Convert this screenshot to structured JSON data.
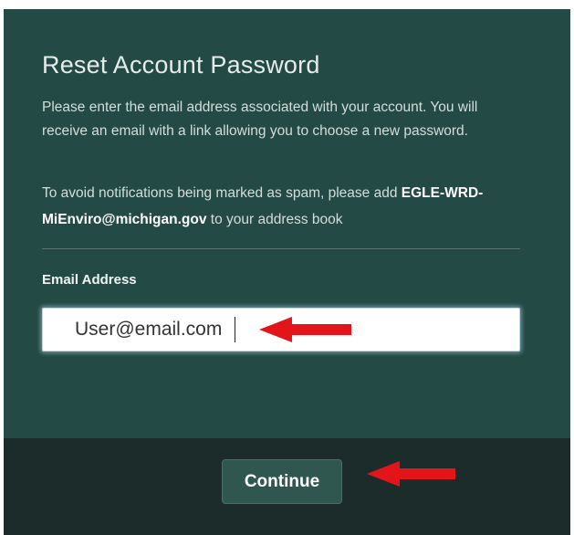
{
  "dialog": {
    "title": "Reset Account Password",
    "description": "Please enter the email address associated with your account. You will receive an email with a link allowing you to choose a new password.",
    "spam_note_prefix": "To avoid notifications being marked as spam, please add ",
    "spam_note_email": "EGLE-WRD-MiEnviro@michigan.gov",
    "spam_note_suffix": " to your address book"
  },
  "form": {
    "email_label": "Email Address",
    "email_value": "User@email.com"
  },
  "footer": {
    "continue_label": "Continue"
  },
  "annotations": {
    "arrow_color": "#e3151a"
  },
  "colors": {
    "dialog_background": "#234a45",
    "footer_background": "#1b2c2b",
    "button_background": "#2f5750"
  }
}
